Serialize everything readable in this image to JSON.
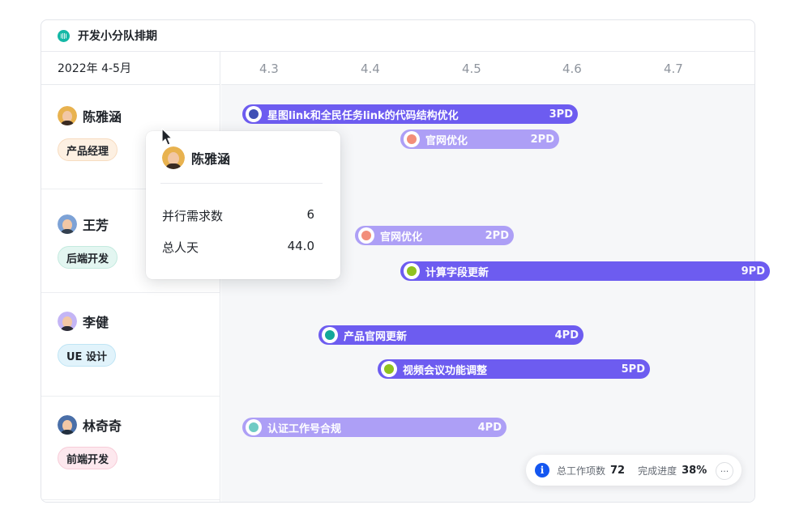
{
  "project": {
    "title": "开发小分队排期",
    "icon": "grid-dots-icon",
    "icon_color": "#14b8a6"
  },
  "date_range": "2022年 4-5月",
  "timeline": {
    "dates": [
      "4.3",
      "4.4",
      "4.5",
      "4.6",
      "4.7"
    ]
  },
  "members": [
    {
      "name": "陈雅涵",
      "role": "产品经理",
      "role_bg": "#fdf0e2",
      "role_color": "#1f2329",
      "role_border": "#f7dcc0"
    },
    {
      "name": "王芳",
      "role": "后端开发",
      "role_bg": "#e3f6f1",
      "role_color": "#1f2329",
      "role_border": "#c4eadf"
    },
    {
      "name": "李健",
      "role": "UE 设计",
      "role_bg": "#e1f3fb",
      "role_color": "#1f2329",
      "role_border": "#bfe5f5"
    },
    {
      "name": "林奇奇",
      "role": "前端开发",
      "role_bg": "#fde8ee",
      "role_color": "#1f2329",
      "role_border": "#f7ccd8"
    }
  ],
  "tasks": [
    {
      "name": "星图link和全民任务link的代码结构优化",
      "pd": "3PD",
      "color": "#6d5cf0",
      "dot": "#4050b5"
    },
    {
      "name": "官网优化",
      "pd": "2PD",
      "color": "#ad9ff6",
      "dot": "#f28e7a"
    },
    {
      "name": "官网优化",
      "pd": "2PD",
      "color": "#ad9ff6",
      "dot": "#f28e7a"
    },
    {
      "name": "计算字段更新",
      "pd": "9PD",
      "color": "#6d5cf0",
      "dot": "#8fc21f"
    },
    {
      "name": "产品官网更新",
      "pd": "4PD",
      "color": "#6d5cf0",
      "dot": "#14a79a"
    },
    {
      "name": "视频会议功能调整",
      "pd": "5PD",
      "color": "#6d5cf0",
      "dot": "#8fc21f"
    },
    {
      "name": "认证工作号合规",
      "pd": "4PD",
      "color": "#ad9ff6",
      "dot": "#6fcbc4"
    }
  ],
  "tooltip": {
    "name": "陈雅涵",
    "rows": [
      {
        "label": "并行需求数",
        "value": "6"
      },
      {
        "label": "总人天",
        "value": "44.0"
      }
    ]
  },
  "summary": {
    "total_label": "总工作项数",
    "total_value": "72",
    "progress_label": "完成进度",
    "progress_value": "38%",
    "more": "···"
  }
}
